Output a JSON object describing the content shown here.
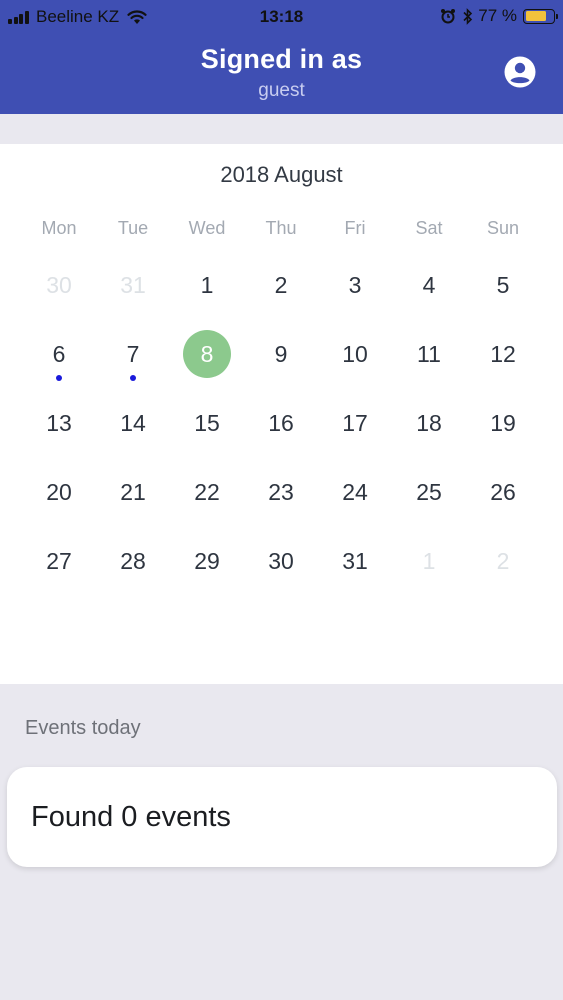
{
  "status_bar": {
    "carrier": "Beeline KZ",
    "time": "13:18",
    "battery": "77 %",
    "battery_level": 0.77
  },
  "header": {
    "title": "Signed in as",
    "subtitle": "guest",
    "account_icon": "account-circle-icon",
    "background": "#3f4fb3"
  },
  "calendar": {
    "month_label": "2018 August",
    "weekdays": [
      "Mon",
      "Tue",
      "Wed",
      "Thu",
      "Fri",
      "Sat",
      "Sun"
    ],
    "weeks": [
      [
        "30",
        "31",
        "1",
        "2",
        "3",
        "4",
        "5"
      ],
      [
        "6",
        "7",
        "8",
        "9",
        "10",
        "11",
        "12"
      ],
      [
        "13",
        "14",
        "15",
        "16",
        "17",
        "18",
        "19"
      ],
      [
        "20",
        "21",
        "22",
        "23",
        "24",
        "25",
        "26"
      ],
      [
        "27",
        "28",
        "29",
        "30",
        "31",
        "1",
        "2"
      ]
    ],
    "selected_day": "8",
    "selected_color": "#8cc98d",
    "event_dot_color": "#1a1adb"
  },
  "events": {
    "section_label": "Events today",
    "count_text": "Found 0 events"
  }
}
